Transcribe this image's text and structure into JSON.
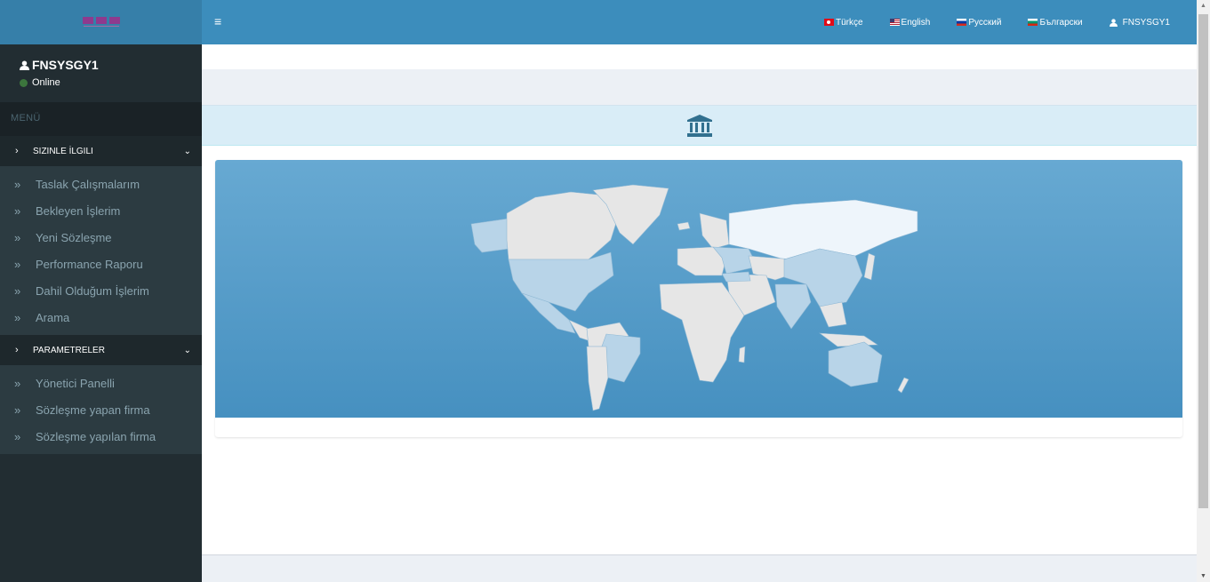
{
  "brand": {
    "logo_text": "HRN"
  },
  "user_panel": {
    "name": "FNSYSGY1",
    "status": "Online"
  },
  "sidebar": {
    "menu_header": "MENÜ",
    "groups": [
      {
        "title": "SIZINLE İLGILI",
        "items": [
          {
            "label": "Taslak Çalışmalarım"
          },
          {
            "label": "Bekleyen İşlerim"
          },
          {
            "label": "Yeni Sözleşme"
          },
          {
            "label": "Performance Raporu"
          },
          {
            "label": "Dahil Olduğum İşlerim"
          },
          {
            "label": "Arama"
          }
        ]
      },
      {
        "title": "PARAMETRELER",
        "items": [
          {
            "label": "Yönetici Panelli"
          },
          {
            "label": "Sözleşme yapan firma"
          },
          {
            "label": "Sözleşme yapılan firma"
          }
        ]
      }
    ]
  },
  "header": {
    "languages": [
      {
        "label": "Türkçe",
        "flag": "flag-tr-icon"
      },
      {
        "label": "English",
        "flag": "flag-us-icon"
      },
      {
        "label": "Русский",
        "flag": "flag-ru-icon"
      },
      {
        "label": "Български",
        "flag": "flag-bg-icon"
      }
    ],
    "user": "FNSYSGY1"
  },
  "colors": {
    "header": "#3c8dbc",
    "sidebar": "#222d32",
    "box_header": "#d9edf7",
    "map_top": "#67a9d2",
    "map_bottom": "#4690c0"
  }
}
